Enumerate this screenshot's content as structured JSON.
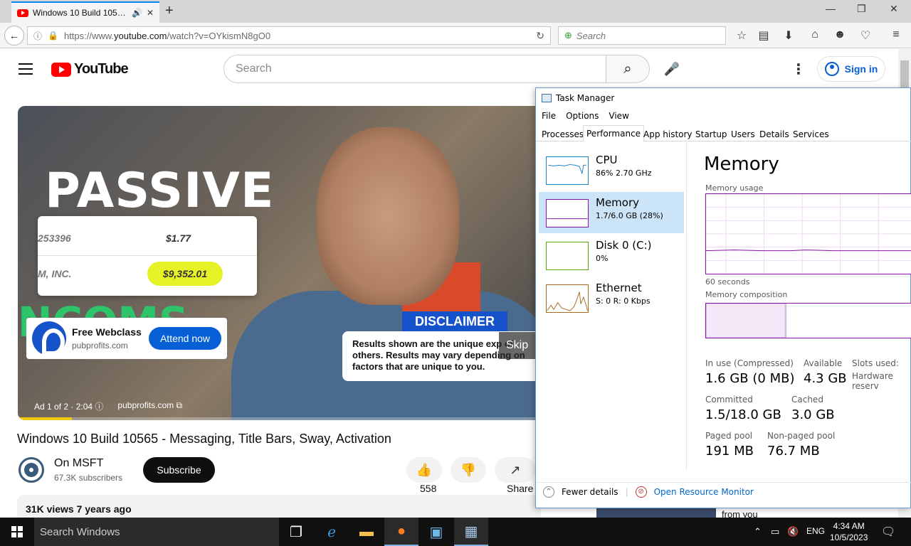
{
  "browser": {
    "tab_title": "Windows 10 Build 105…",
    "url_prefix": "https://www.",
    "url_domain": "youtube.com",
    "url_rest": "/watch?v=OYkismN8gO0",
    "search_placeholder": "Search"
  },
  "youtube": {
    "logo_text": "YouTube",
    "search_placeholder": "Search",
    "sign_in": "Sign in",
    "ad": {
      "title": "Free Webclass",
      "url": "pubprofits.com",
      "cta": "Attend now",
      "info": "Ad 1 of 2 · 2:04",
      "info_link": "pubprofits.com",
      "skip": "Skip",
      "progress_fraction": 0.1
    },
    "video_text": {
      "passive": "PASSIVE",
      "row1_a": "253396",
      "row1_b": "$1.77",
      "row2_a": "M, INC.",
      "row2_b": "$9,352.01",
      "green": "NCOMS",
      "disclaimer": "DISCLAIMER",
      "results": "Results shown are the unique exp of others. Results may vary depending on factors that are unique to you."
    },
    "video_title": "Windows 10 Build 10565 - Messaging, Title Bars, Sway, Activation",
    "channel": "On MSFT",
    "subscribers": "67.3K subscribers",
    "subscribe": "Subscribe",
    "likes": "558",
    "share": "Share",
    "views": "31K views  7 years ago",
    "side_text": "from you"
  },
  "taskmanager": {
    "title": "Task Manager",
    "menu": [
      "File",
      "Options",
      "View"
    ],
    "tabs": [
      "Processes",
      "Performance",
      "App history",
      "Startup",
      "Users",
      "Details",
      "Services"
    ],
    "items": [
      {
        "name": "CPU",
        "value": "86% 2.70 GHz",
        "color": "#1b7fc4"
      },
      {
        "name": "Memory",
        "value": "1.7/6.0 GB (28%)",
        "color": "#8b12ae"
      },
      {
        "name": "Disk 0 (C:)",
        "value": "0%",
        "color": "#4da60c"
      },
      {
        "name": "Ethernet",
        "value": "S: 0 R: 0 Kbps",
        "color": "#a7691b"
      }
    ],
    "heading": "Memory",
    "usage_label": "Memory usage",
    "seconds_label": "60 seconds",
    "composition_label": "Memory composition",
    "stats": {
      "in_use_label": "In use (Compressed)",
      "in_use": "1.6 GB (0 MB)",
      "available_label": "Available",
      "available": "4.3 GB",
      "slots_label": "Slots used:",
      "hw_label": "Hardware reserv",
      "committed_label": "Committed",
      "committed": "1.5/18.0 GB",
      "cached_label": "Cached",
      "cached": "3.0 GB",
      "paged_label": "Paged pool",
      "paged": "191 MB",
      "nonpaged_label": "Non-paged pool",
      "nonpaged": "76.7 MB"
    },
    "fewer_details": "Fewer details",
    "resource_monitor": "Open Resource Monitor"
  },
  "taskbar": {
    "search": "Search Windows",
    "lang": "ENG",
    "time": "4:34 AM",
    "date": "10/5/2023"
  }
}
